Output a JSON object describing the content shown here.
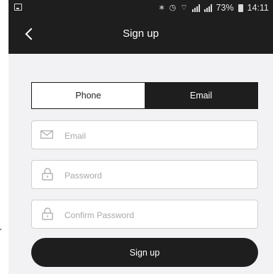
{
  "status_bar": {
    "battery": "73%",
    "time": "14:11"
  },
  "header": {
    "title": "Sign up",
    "back_icon": "chevron-left-icon"
  },
  "tabs": [
    {
      "label": "Phone",
      "active": false
    },
    {
      "label": "Email",
      "active": true
    }
  ],
  "form": {
    "email": {
      "placeholder": "Email",
      "value": "",
      "icon": "mail-icon"
    },
    "password": {
      "placeholder": "Password",
      "value": "",
      "icon": "lock-icon"
    },
    "confirm_password": {
      "placeholder": "Confirm Password",
      "value": "",
      "icon": "lock-icon"
    }
  },
  "submit": {
    "label": "Sign up"
  },
  "colors": {
    "bar": "#1e1e1e",
    "background": "#f2f2f4",
    "border": "#cfcfcf"
  }
}
